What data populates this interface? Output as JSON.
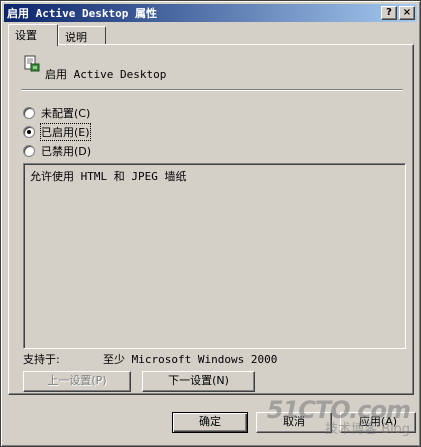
{
  "window": {
    "title": "启用 Active Desktop 属性",
    "help_btn": "?",
    "close_btn": "×"
  },
  "tabs": [
    {
      "label": "设置",
      "active": true
    },
    {
      "label": "说明",
      "active": false
    }
  ],
  "policy": {
    "name": "启用 Active Desktop",
    "icon": "policy-setting-icon"
  },
  "options": [
    {
      "label": "未配置(C)",
      "checked": false
    },
    {
      "label": "已启用(E)",
      "checked": true
    },
    {
      "label": "已禁用(D)",
      "checked": false
    }
  ],
  "description": "允许使用 HTML 和 JPEG 墙纸",
  "supported": {
    "label": "支持于:",
    "value": "至少 Microsoft Windows 2000"
  },
  "nav": {
    "prev_label": "上一设置(P)",
    "next_label": "下一设置(N)"
  },
  "buttons": {
    "ok": "确定",
    "cancel": "取消",
    "apply": "应用(A)"
  },
  "watermark": {
    "line1": "51CTO.com",
    "line2": "技术博客",
    "line3": "Blog"
  },
  "colors": {
    "title_start": "#0a246a",
    "title_end": "#a6caf0",
    "face": "#d4d0c8"
  }
}
